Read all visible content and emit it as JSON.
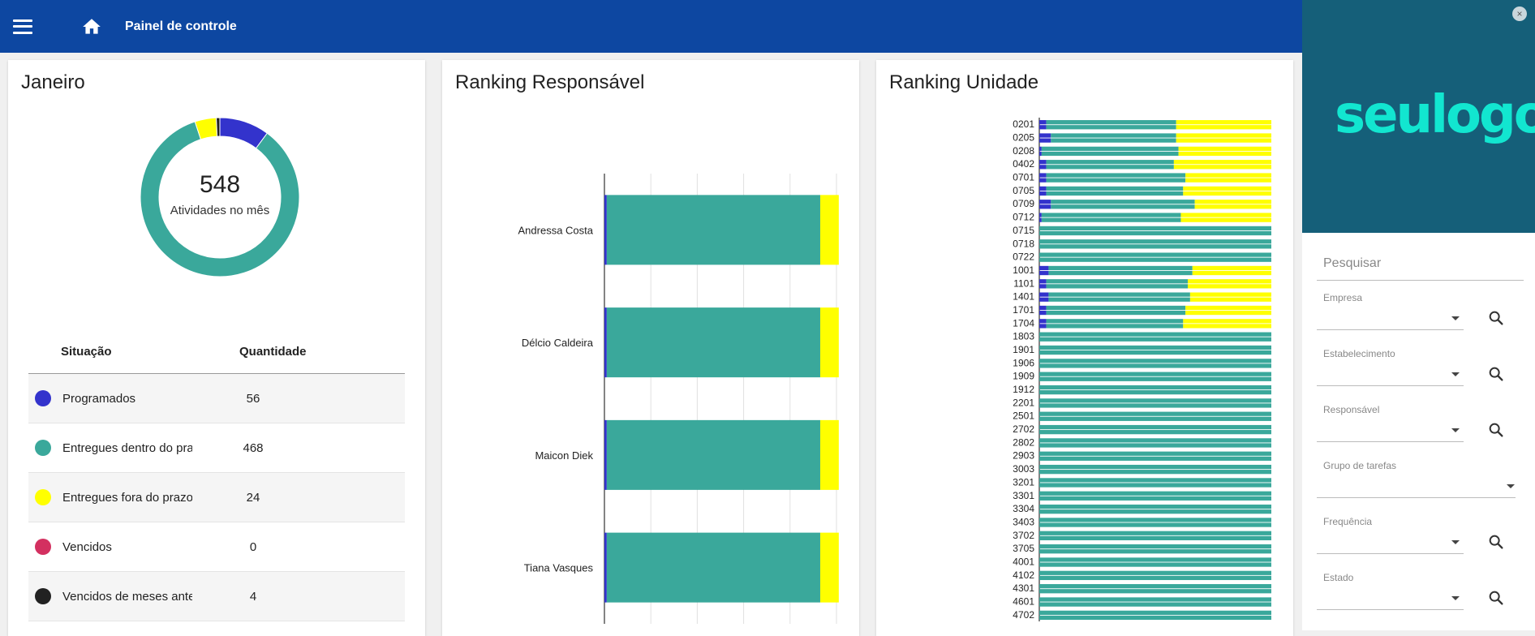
{
  "header": {
    "title": "Painel de controle"
  },
  "colors": {
    "programados": "#3333cc",
    "dentro": "#3aa89b",
    "fora": "#ffff00",
    "vencidos": "#d33060",
    "anteriores": "#222222",
    "topbar": "#0d47a1"
  },
  "donut": {
    "title": "Janeiro",
    "total": "548",
    "subtitle": "Atividades no mês",
    "columns": {
      "situacao": "Situação",
      "quantidade": "Quantidade"
    },
    "rows": [
      {
        "label": "Programados",
        "value": "56",
        "color": "#3333cc"
      },
      {
        "label": "Entregues dentro do prazo",
        "value": "468",
        "color": "#3aa89b"
      },
      {
        "label": "Entregues fora do prazo",
        "value": "24",
        "color": "#ffff00"
      },
      {
        "label": "Vencidos",
        "value": "0",
        "color": "#d33060"
      },
      {
        "label": "Vencidos de meses anteriores",
        "value": "4",
        "color": "#222222"
      }
    ]
  },
  "ranking_responsavel": {
    "title": "Ranking Responsável",
    "names": [
      "Andressa Costa",
      "Délcio Caldeira",
      "Maicon Diek",
      "Tiana Vasques"
    ]
  },
  "ranking_unidade": {
    "title": "Ranking Unidade",
    "labels": [
      "0201",
      "0205",
      "0208",
      "0402",
      "0701",
      "0705",
      "0709",
      "0712",
      "0715",
      "0718",
      "0722",
      "1001",
      "1101",
      "1401",
      "1701",
      "1704",
      "1803",
      "1901",
      "1906",
      "1909",
      "1912",
      "2201",
      "2501",
      "2702",
      "2802",
      "2903",
      "3003",
      "3201",
      "3301",
      "3304",
      "3403",
      "3702",
      "3705",
      "4001",
      "4102",
      "4301",
      "4601",
      "4702"
    ]
  },
  "chart_data": [
    {
      "type": "pie",
      "title": "Janeiro",
      "categories": [
        "Programados",
        "Entregues dentro do prazo",
        "Entregues fora do prazo",
        "Vencidos",
        "Vencidos de meses anteriores"
      ],
      "values": [
        56,
        468,
        24,
        0,
        4
      ]
    },
    {
      "type": "bar",
      "title": "Ranking Responsável",
      "orientation": "horizontal",
      "stacked": true,
      "categories": [
        "Andressa Costa",
        "Délcio Caldeira",
        "Maicon Diek",
        "Tiana Vasques"
      ],
      "series": [
        {
          "color": "#3333cc",
          "values": [
            1,
            1,
            1,
            1
          ]
        },
        {
          "color": "#3aa89b",
          "values": [
            92,
            92,
            92,
            92
          ]
        },
        {
          "color": "#ffff00",
          "values": [
            8,
            8,
            8,
            8
          ]
        }
      ],
      "xlim": [
        0,
        100
      ]
    },
    {
      "type": "bar",
      "title": "Ranking Unidade",
      "orientation": "horizontal",
      "stacked": true,
      "categories": [
        "0201",
        "0205",
        "0208",
        "0402",
        "0701",
        "0705",
        "0709",
        "0712",
        "0715",
        "0718",
        "0722",
        "1001",
        "1101",
        "1401",
        "1701",
        "1704",
        "1803",
        "1901",
        "1906",
        "1909",
        "1912",
        "2201",
        "2501",
        "2702",
        "2802",
        "2903",
        "3003",
        "3201",
        "3301",
        "3304",
        "3403",
        "3702",
        "3705",
        "4001",
        "4102",
        "4301",
        "4601",
        "4702"
      ],
      "series": [
        {
          "color": "#3333cc",
          "values": [
            3,
            5,
            1,
            3,
            3,
            3,
            5,
            1,
            0,
            0,
            0,
            4,
            3,
            4,
            3,
            3,
            0,
            0,
            0,
            0,
            0,
            0,
            0,
            0,
            0,
            0,
            0,
            0,
            0,
            0,
            0,
            0,
            0,
            0,
            0,
            0,
            0,
            0
          ]
        },
        {
          "color": "#3aa89b",
          "values": [
            56,
            54,
            59,
            55,
            60,
            59,
            62,
            60,
            100,
            100,
            100,
            62,
            61,
            61,
            60,
            59,
            100,
            100,
            100,
            100,
            100,
            100,
            100,
            100,
            100,
            100,
            100,
            100,
            100,
            100,
            100,
            100,
            100,
            100,
            100,
            100,
            100,
            100
          ]
        },
        {
          "color": "#ffff00",
          "values": [
            41,
            41,
            40,
            42,
            37,
            38,
            33,
            39,
            0,
            0,
            0,
            34,
            36,
            35,
            37,
            38,
            0,
            0,
            0,
            0,
            0,
            0,
            0,
            0,
            0,
            0,
            0,
            0,
            0,
            0,
            0,
            0,
            0,
            0,
            0,
            0,
            0,
            0
          ]
        }
      ],
      "xlim": [
        0,
        100
      ]
    }
  ],
  "sidebar": {
    "logo": "seulogo",
    "close": "×",
    "search_placeholder": "Pesquisar",
    "filters": [
      {
        "label": "Empresa",
        "has_search": true
      },
      {
        "label": "Estabelecimento",
        "has_search": true
      },
      {
        "label": "Responsável",
        "has_search": true
      },
      {
        "label": "Grupo de tarefas",
        "has_search": false
      },
      {
        "label": "Frequência",
        "has_search": true
      },
      {
        "label": "Estado",
        "has_search": true
      }
    ]
  }
}
